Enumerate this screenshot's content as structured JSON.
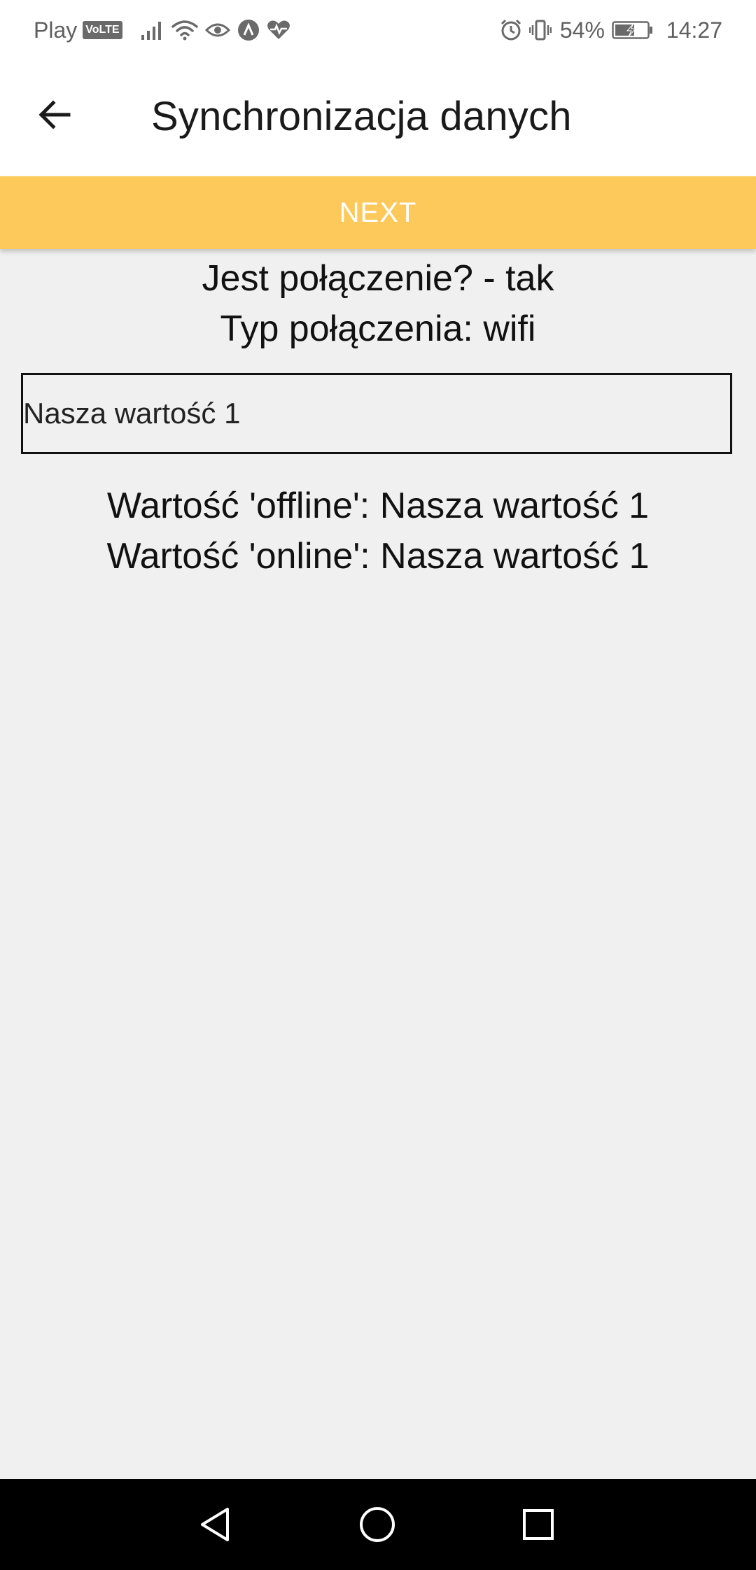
{
  "status_bar": {
    "carrier": "Play",
    "volte": "VoLTE",
    "battery_percent": "54%",
    "time": "14:27",
    "icons": [
      "signal-icon",
      "wifi-icon",
      "eye-icon",
      "app-a-icon",
      "heart-pulse-icon",
      "alarm-icon",
      "vibrate-icon",
      "battery-charging-icon"
    ]
  },
  "app_bar": {
    "title": "Synchronizacja danych",
    "back_icon": "arrow-left-icon"
  },
  "next_button": {
    "label": "NEXT",
    "color": "#fcc95a"
  },
  "connection": {
    "status_line": "Jest połączenie? - tak",
    "type_line": "Typ połączenia: wifi"
  },
  "input": {
    "value": "Nasza wartość 1"
  },
  "values": {
    "offline_line": "Wartość 'offline': Nasza wartość 1",
    "online_line": "Wartość 'online': Nasza wartość 1"
  },
  "nav_bar": {
    "icons": [
      "nav-back-icon",
      "nav-home-icon",
      "nav-recents-icon"
    ]
  },
  "colors": {
    "background": "#f0f0f0",
    "app_bar": "#ffffff",
    "accent": "#fcc95a",
    "nav_bar": "#000000"
  }
}
